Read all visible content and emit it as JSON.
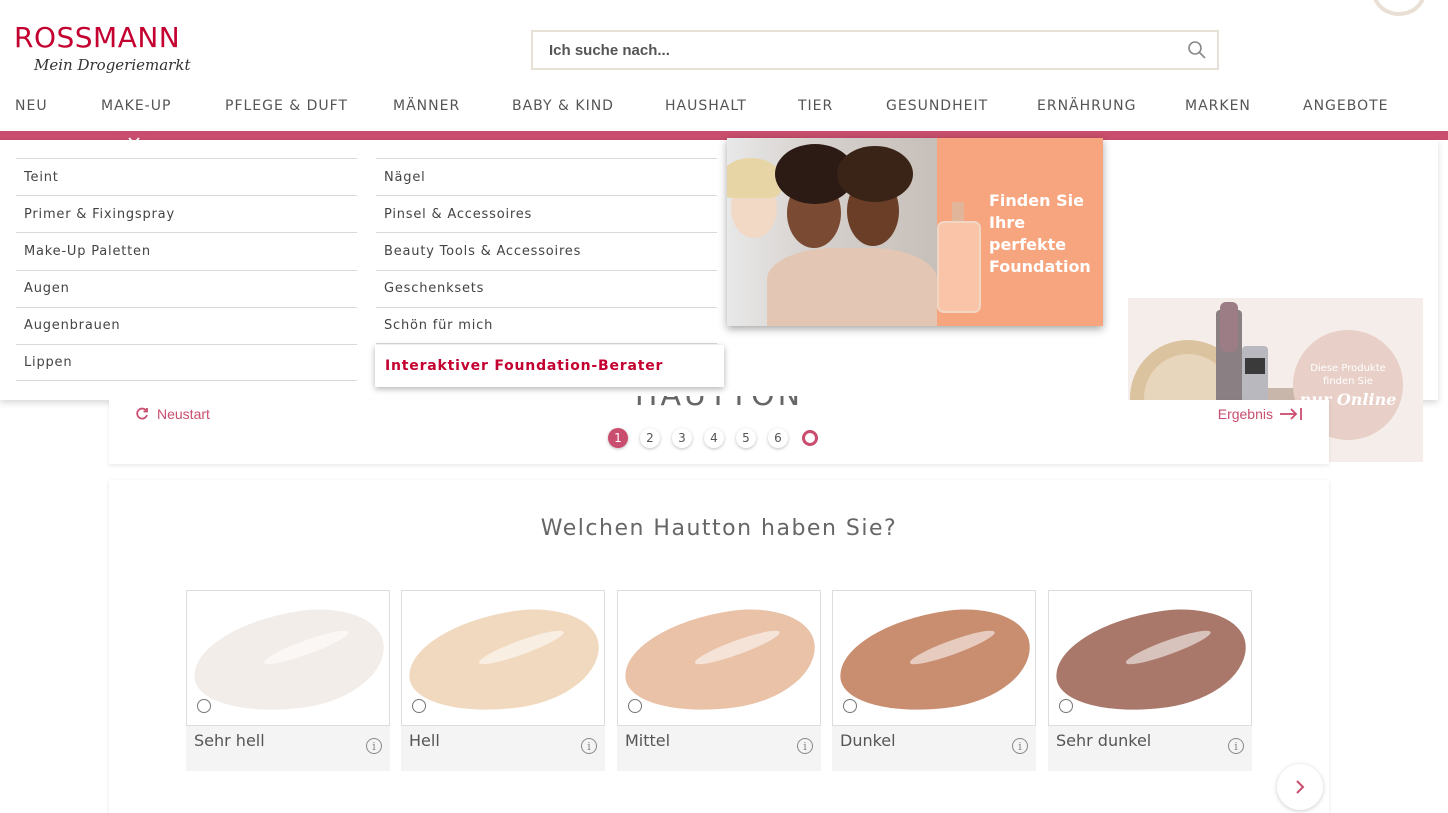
{
  "brand": {
    "name": "ROSSMANN",
    "tagline": "Mein Drogeriemarkt",
    "color": "#c3002f",
    "accent": "#c94d6e"
  },
  "search": {
    "placeholder": "Ich suche nach...",
    "icon": "search-icon"
  },
  "nav": [
    {
      "label": "NEU"
    },
    {
      "label": "MAKE-UP"
    },
    {
      "label": "PFLEGE & DUFT"
    },
    {
      "label": "MÄNNER"
    },
    {
      "label": "BABY & KIND"
    },
    {
      "label": "HAUSHALT"
    },
    {
      "label": "TIER"
    },
    {
      "label": "GESUNDHEIT"
    },
    {
      "label": "ERNÄHRUNG"
    },
    {
      "label": "MARKEN"
    },
    {
      "label": "ANGEBOTE"
    }
  ],
  "mega_menu": {
    "col1": [
      "Teint",
      "Primer & Fixingspray",
      "Make-Up Paletten",
      "Augen",
      "Augenbrauen",
      "Lippen"
    ],
    "col2": [
      "Nägel",
      "Pinsel & Accessoires",
      "Beauty Tools & Accessoires",
      "Geschenksets",
      "Schön für mich"
    ],
    "highlight": "Interaktiver Foundation-Berater",
    "promo1_text": "Finden Sie\nIhre perfekte\nFoundation",
    "promo2_text": "Diese Produkte\nfinden Sie",
    "promo2_emph": "nur Online"
  },
  "stepper": {
    "title": "HAUTTON",
    "restart_label": "Neustart",
    "result_label": "Ergebnis",
    "steps": [
      "1",
      "2",
      "3",
      "4",
      "5",
      "6"
    ],
    "active_step": 1
  },
  "question": {
    "title": "Welchen Hautton haben Sie?",
    "options": [
      {
        "label": "Sehr hell",
        "color": "#f3ede9"
      },
      {
        "label": "Hell",
        "color": "#f1d9bf"
      },
      {
        "label": "Mittel",
        "color": "#e9c2a8"
      },
      {
        "label": "Dunkel",
        "color": "#c98d70"
      },
      {
        "label": "Sehr dunkel",
        "color": "#a9786a"
      }
    ]
  }
}
